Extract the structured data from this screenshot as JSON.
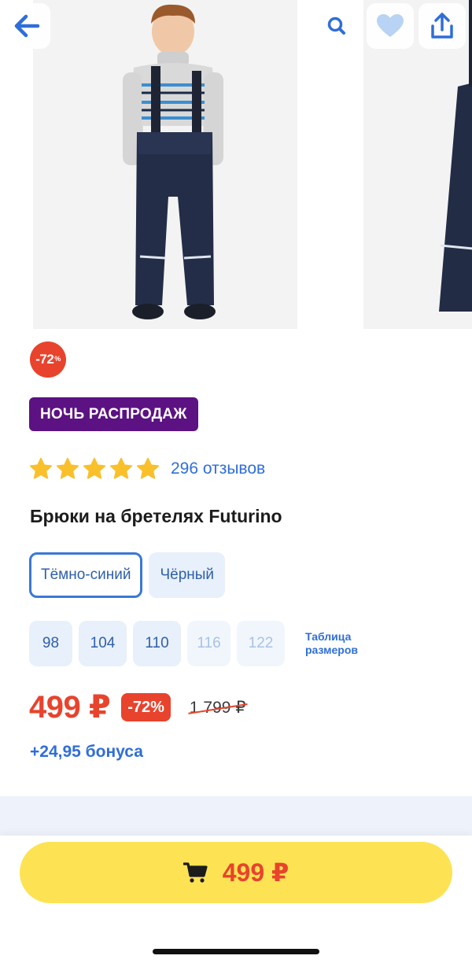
{
  "header": {
    "back_icon": "arrow-left-icon",
    "search_icon": "search-icon",
    "favorite_icon": "heart-icon",
    "share_icon": "share-icon"
  },
  "product": {
    "discount_badge_value": "-72",
    "discount_badge_unit": "%",
    "promo_label": "НОЧЬ РАСПРОДАЖ",
    "rating_stars": 5,
    "reviews_text": "296 отзывов",
    "title": "Брюки на бретелях Futurino",
    "colors": [
      {
        "label": "Тёмно-синий",
        "selected": true
      },
      {
        "label": "Чёрный",
        "selected": false
      }
    ],
    "sizes": [
      {
        "label": "98",
        "available": true
      },
      {
        "label": "104",
        "available": true
      },
      {
        "label": "110",
        "available": true
      },
      {
        "label": "116",
        "available": false
      },
      {
        "label": "122",
        "available": false
      }
    ],
    "size_table_link": "Таблица размеров",
    "price_current": "499 ₽",
    "price_discount": "-72%",
    "price_old": "1 799 ₽",
    "bonus_text": "+24,95 бонуса"
  },
  "cart": {
    "icon": "cart-icon",
    "price": "499 ₽"
  },
  "colors": {
    "accent_blue": "#2f6ed8",
    "sale_red": "#e8432d",
    "promo_purple": "#5c1282",
    "cart_yellow": "#fde354",
    "star_yellow": "#f9c02b"
  }
}
